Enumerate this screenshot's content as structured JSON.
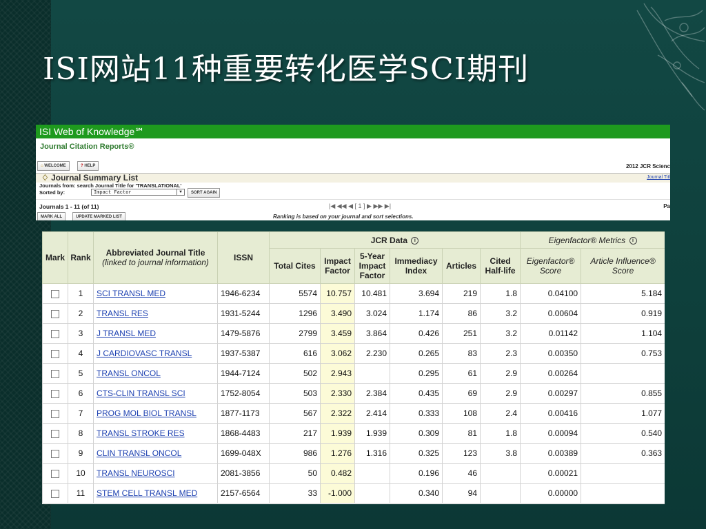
{
  "slide": {
    "title": "ISI网站11种重要转化医学SCI期刊"
  },
  "isi": {
    "topbar": "ISI Web of Knowledge℠ ",
    "subtitle": "Journal Citation Reports®",
    "welcome_button": "WELCOME",
    "help_button": "HELP",
    "edition": "2012 JCR Scienc",
    "summary_title": "Journal Summary List",
    "journal_title_link": "Journal Titl",
    "journals_from_label": "Journals from:",
    "journals_from_value": "search Journal Title for 'TRANSLATIONAL'",
    "sorted_by_label": "Sorted by:",
    "sorted_by_value": "Impact Factor",
    "sort_again_button": "SORT AGAIN",
    "journals_count": "Journals 1 - 11 (of 11)",
    "pager": "|◀  ◀◀  ◀ [ 1 ] ▶  ▶▶  ▶|",
    "pa_label": "Pa",
    "mark_all_button": "MARK ALL",
    "update_marked_button": "UPDATE MARKED LIST",
    "ranking_note": "Ranking is based on your journal and sort selections."
  },
  "table": {
    "group_jcr": "JCR Data",
    "group_eigen": "Eigenfactor® Metrics",
    "headers": {
      "mark": "Mark",
      "rank": "Rank",
      "title_main": "Abbreviated Journal Title",
      "title_sub": "(linked to journal information)",
      "issn": "ISSN",
      "total_cites": "Total Cites",
      "impact_factor": "Impact Factor",
      "five_year": "5-Year Impact Factor",
      "immediacy": "Immediacy Index",
      "articles": "Articles",
      "cited_half_life": "Cited Half-life",
      "eigenfactor_score": "Eigenfactor® Score",
      "article_influence": "Article Influence® Score"
    },
    "rows": [
      {
        "rank": "1",
        "title": "SCI TRANSL MED",
        "issn": "1946-6234",
        "cites": "5574",
        "if": "10.757",
        "if5": "10.481",
        "imm": "3.694",
        "articles": "219",
        "half": "1.8",
        "eigen": "0.04100",
        "ai": "5.184"
      },
      {
        "rank": "2",
        "title": "TRANSL RES",
        "issn": "1931-5244",
        "cites": "1296",
        "if": "3.490",
        "if5": "3.024",
        "imm": "1.174",
        "articles": "86",
        "half": "3.2",
        "eigen": "0.00604",
        "ai": "0.919"
      },
      {
        "rank": "3",
        "title": "J TRANSL MED",
        "issn": "1479-5876",
        "cites": "2799",
        "if": "3.459",
        "if5": "3.864",
        "imm": "0.426",
        "articles": "251",
        "half": "3.2",
        "eigen": "0.01142",
        "ai": "1.104"
      },
      {
        "rank": "4",
        "title": "J CARDIOVASC TRANSL",
        "issn": "1937-5387",
        "cites": "616",
        "if": "3.062",
        "if5": "2.230",
        "imm": "0.265",
        "articles": "83",
        "half": "2.3",
        "eigen": "0.00350",
        "ai": "0.753"
      },
      {
        "rank": "5",
        "title": "TRANSL ONCOL",
        "issn": "1944-7124",
        "cites": "502",
        "if": "2.943",
        "if5": "",
        "imm": "0.295",
        "articles": "61",
        "half": "2.9",
        "eigen": "0.00264",
        "ai": ""
      },
      {
        "rank": "6",
        "title": "CTS-CLIN TRANSL SCI",
        "issn": "1752-8054",
        "cites": "503",
        "if": "2.330",
        "if5": "2.384",
        "imm": "0.435",
        "articles": "69",
        "half": "2.9",
        "eigen": "0.00297",
        "ai": "0.855"
      },
      {
        "rank": "7",
        "title": "PROG MOL BIOL TRANSL",
        "issn": "1877-1173",
        "cites": "567",
        "if": "2.322",
        "if5": "2.414",
        "imm": "0.333",
        "articles": "108",
        "half": "2.4",
        "eigen": "0.00416",
        "ai": "1.077"
      },
      {
        "rank": "8",
        "title": "TRANSL STROKE RES",
        "issn": "1868-4483",
        "cites": "217",
        "if": "1.939",
        "if5": "1.939",
        "imm": "0.309",
        "articles": "81",
        "half": "1.8",
        "eigen": "0.00094",
        "ai": "0.540"
      },
      {
        "rank": "9",
        "title": "CLIN TRANSL ONCOL",
        "issn": "1699-048X",
        "cites": "986",
        "if": "1.276",
        "if5": "1.316",
        "imm": "0.325",
        "articles": "123",
        "half": "3.8",
        "eigen": "0.00389",
        "ai": "0.363"
      },
      {
        "rank": "10",
        "title": "TRANSL NEUROSCI",
        "issn": "2081-3856",
        "cites": "50",
        "if": "0.482",
        "if5": "",
        "imm": "0.196",
        "articles": "46",
        "half": "",
        "eigen": "0.00021",
        "ai": ""
      },
      {
        "rank": "11",
        "title": "STEM CELL TRANSL MED",
        "issn": "2157-6564",
        "cites": "33",
        "if": "-1.000",
        "if5": "",
        "imm": "0.340",
        "articles": "94",
        "half": "",
        "eigen": "0.00000",
        "ai": ""
      }
    ]
  },
  "colors": {
    "slide_bg": "#0e3e3a",
    "isi_green": "#1e9a1e",
    "link_blue": "#1b3fb0",
    "header_bg": "#e6ecd3",
    "impact_highlight": "#fcfbd7"
  }
}
